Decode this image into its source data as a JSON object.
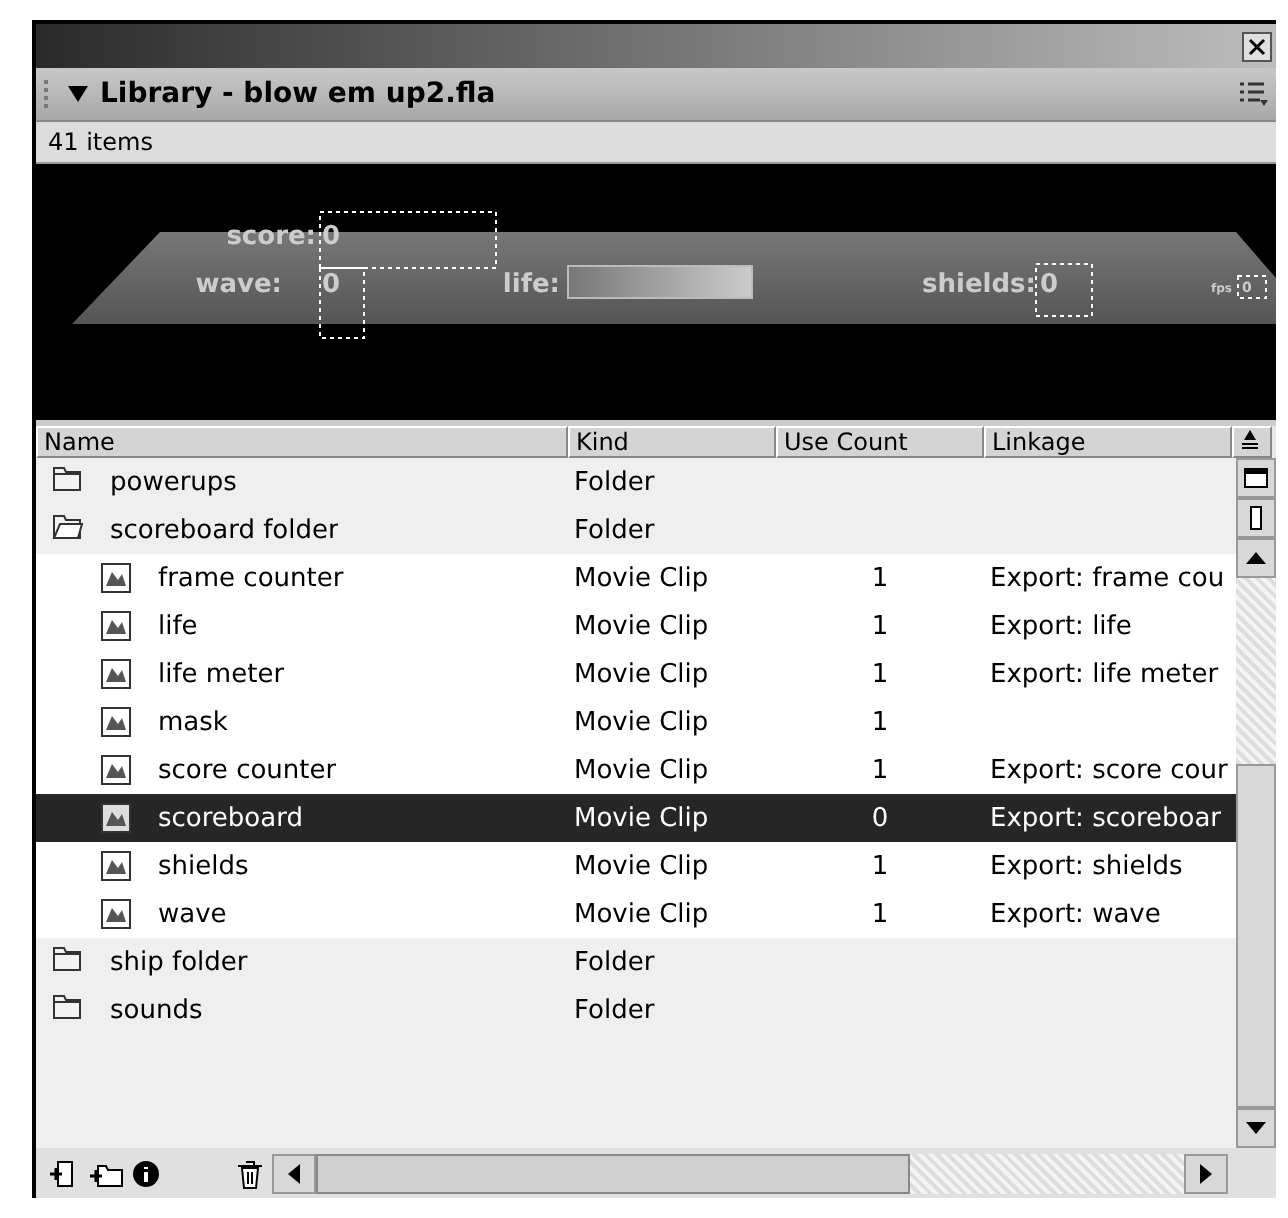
{
  "panel": {
    "title": "Library - blow em up2.fla",
    "item_count": "41 items"
  },
  "preview": {
    "labels": [
      {
        "kind": "score",
        "label": "score:",
        "value": "0"
      },
      {
        "kind": "wave",
        "label": "wave:",
        "value": "0"
      },
      {
        "kind": "life",
        "label": "life:"
      },
      {
        "kind": "shields",
        "label": "shields:",
        "value": "0"
      },
      {
        "kind": "fps",
        "label": "fps",
        "value": "0"
      }
    ]
  },
  "table": {
    "columns": [
      "Name",
      "Kind",
      "Use Count",
      "Linkage"
    ],
    "rows": [
      {
        "kind": "folder",
        "name": "powerups",
        "kind_label": "Folder",
        "expanded": false,
        "selected": false
      },
      {
        "kind": "folder",
        "name": "scoreboard folder",
        "kind_label": "Folder",
        "expanded": true,
        "selected": false,
        "children": [
          {
            "kind": "clip",
            "name": "frame counter",
            "kind_label": "Movie Clip",
            "use_count": "1",
            "linkage": "Export: frame cou",
            "selected": false
          },
          {
            "kind": "clip",
            "name": "life",
            "kind_label": "Movie Clip",
            "use_count": "1",
            "linkage": "Export: life",
            "selected": false
          },
          {
            "kind": "clip",
            "name": "life meter",
            "kind_label": "Movie Clip",
            "use_count": "1",
            "linkage": "Export: life meter",
            "selected": false
          },
          {
            "kind": "clip",
            "name": "mask",
            "kind_label": "Movie Clip",
            "use_count": "1",
            "selected": false
          },
          {
            "kind": "clip",
            "name": "score counter",
            "kind_label": "Movie Clip",
            "use_count": "1",
            "linkage": "Export: score cour",
            "selected": false
          },
          {
            "kind": "clip",
            "name": "scoreboard",
            "kind_label": "Movie Clip",
            "use_count": "0",
            "linkage": "Export: scoreboar",
            "selected": true
          },
          {
            "kind": "clip",
            "name": "shields",
            "kind_label": "Movie Clip",
            "use_count": "1",
            "linkage": "Export: shields",
            "selected": false
          },
          {
            "kind": "clip",
            "name": "wave",
            "kind_label": "Movie Clip",
            "use_count": "1",
            "linkage": "Export: wave",
            "selected": false
          }
        ]
      },
      {
        "kind": "folder",
        "name": "ship folder",
        "kind_label": "Folder",
        "expanded": false,
        "selected": false
      },
      {
        "kind": "folder",
        "name": "sounds",
        "kind_label": "Folder",
        "expanded": false,
        "selected": false
      }
    ]
  }
}
